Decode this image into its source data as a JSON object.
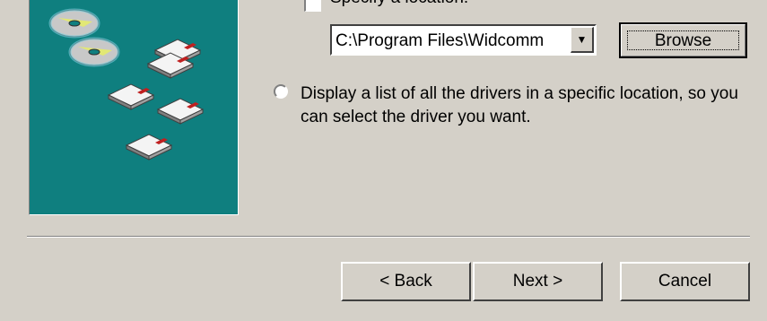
{
  "search_option": {
    "checkbox_label": "Specify a location:",
    "location_value": "C:\\Program Files\\Widcomm",
    "browse_label": "Browse"
  },
  "display_option": {
    "text": "Display a list of all the drivers in a specific location, so you can select the driver you want."
  },
  "nav": {
    "back_label": "< Back",
    "next_label": "Next >",
    "cancel_label": "Cancel"
  },
  "icons": {
    "dropdown": "chevron-down-icon",
    "illustration": "cd-and-floppy-icons"
  }
}
